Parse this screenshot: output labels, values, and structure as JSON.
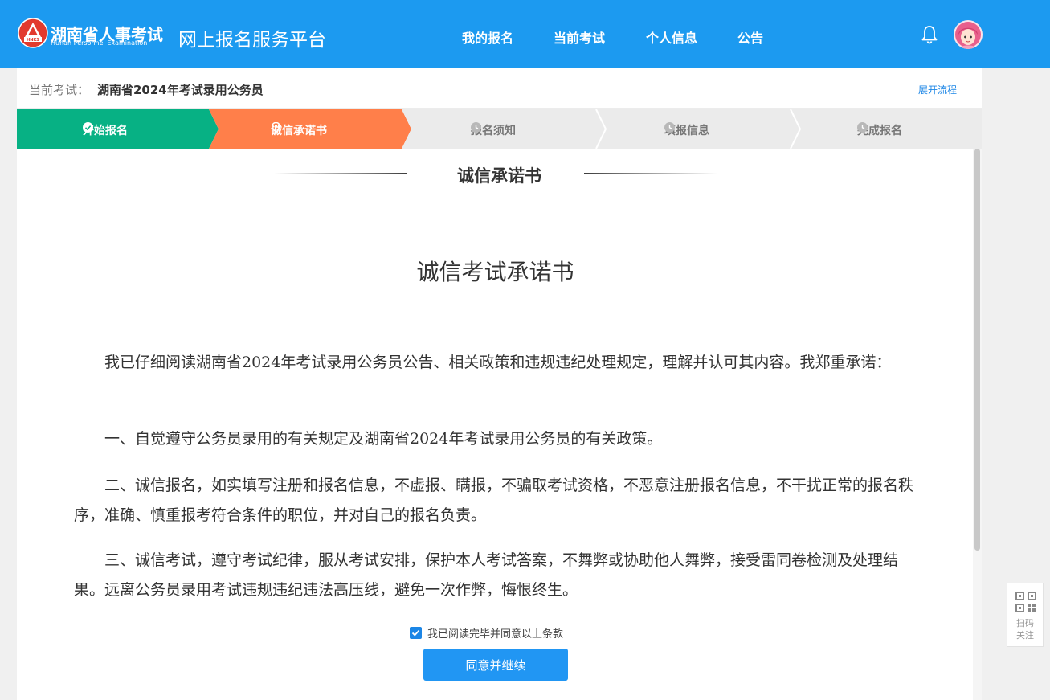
{
  "header": {
    "brand_zh": "湖南省人事考试",
    "brand_en": "Hunan Personnel Examination",
    "logo_text": "HNKS",
    "platform_title": "网上报名服务平台",
    "nav": [
      "我的报名",
      "当前考试",
      "个人信息",
      "公告"
    ],
    "bell_icon": "bell-icon",
    "avatar_icon": "user-avatar"
  },
  "exam": {
    "label": "当前考试：",
    "name": "湖南省2024年考试录用公务员",
    "expand_link": "展开流程"
  },
  "steps": [
    {
      "label": "开始报名",
      "state": "done",
      "icon": "check-circle-icon"
    },
    {
      "label": "诚信承诺书",
      "state": "active",
      "icon": "location-pin-icon"
    },
    {
      "label": "报名须知",
      "state": "pending",
      "icon": "clock-icon"
    },
    {
      "label": "填报信息",
      "state": "pending",
      "icon": "clock-icon"
    },
    {
      "label": "完成报名",
      "state": "pending",
      "icon": "clock-icon"
    }
  ],
  "section_title": "诚信承诺书",
  "document": {
    "title": "诚信考试承诺书",
    "paragraphs": [
      "我已仔细阅读湖南省2024年考试录用公务员公告、相关政策和违规违纪处理规定，理解并认可其内容。我郑重承诺：",
      "一、自觉遵守公务员录用的有关规定及湖南省2024年考试录用公务员的有关政策。",
      "二、诚信报名，如实填写注册和报名信息，不虚报、瞒报，不骗取考试资格，不恶意注册报名信息，不干扰正常的报名秩序，准确、慎重报考符合条件的职位，并对自己的报名负责。",
      "三、诚信考试，遵守考试纪律，服从考试安排，保护本人考试答案，不舞弊或协助他人舞弊，接受雷同卷检测及处理结果。远离公务员录用考试违规违纪违法高压线，避免一次作弊，悔恨终生。"
    ]
  },
  "agreement": {
    "checked": true,
    "label": "我已阅读完毕并同意以上条款",
    "button": "同意并继续"
  },
  "qr_widget": {
    "line1": "扫码",
    "line2": "关注"
  },
  "colors": {
    "header_bg": "#1c9af0",
    "step_done": "#07b184",
    "step_active": "#ff7f4a",
    "step_pending": "#ebebeb",
    "primary_button": "#2196f3",
    "link": "#1c86e6"
  }
}
